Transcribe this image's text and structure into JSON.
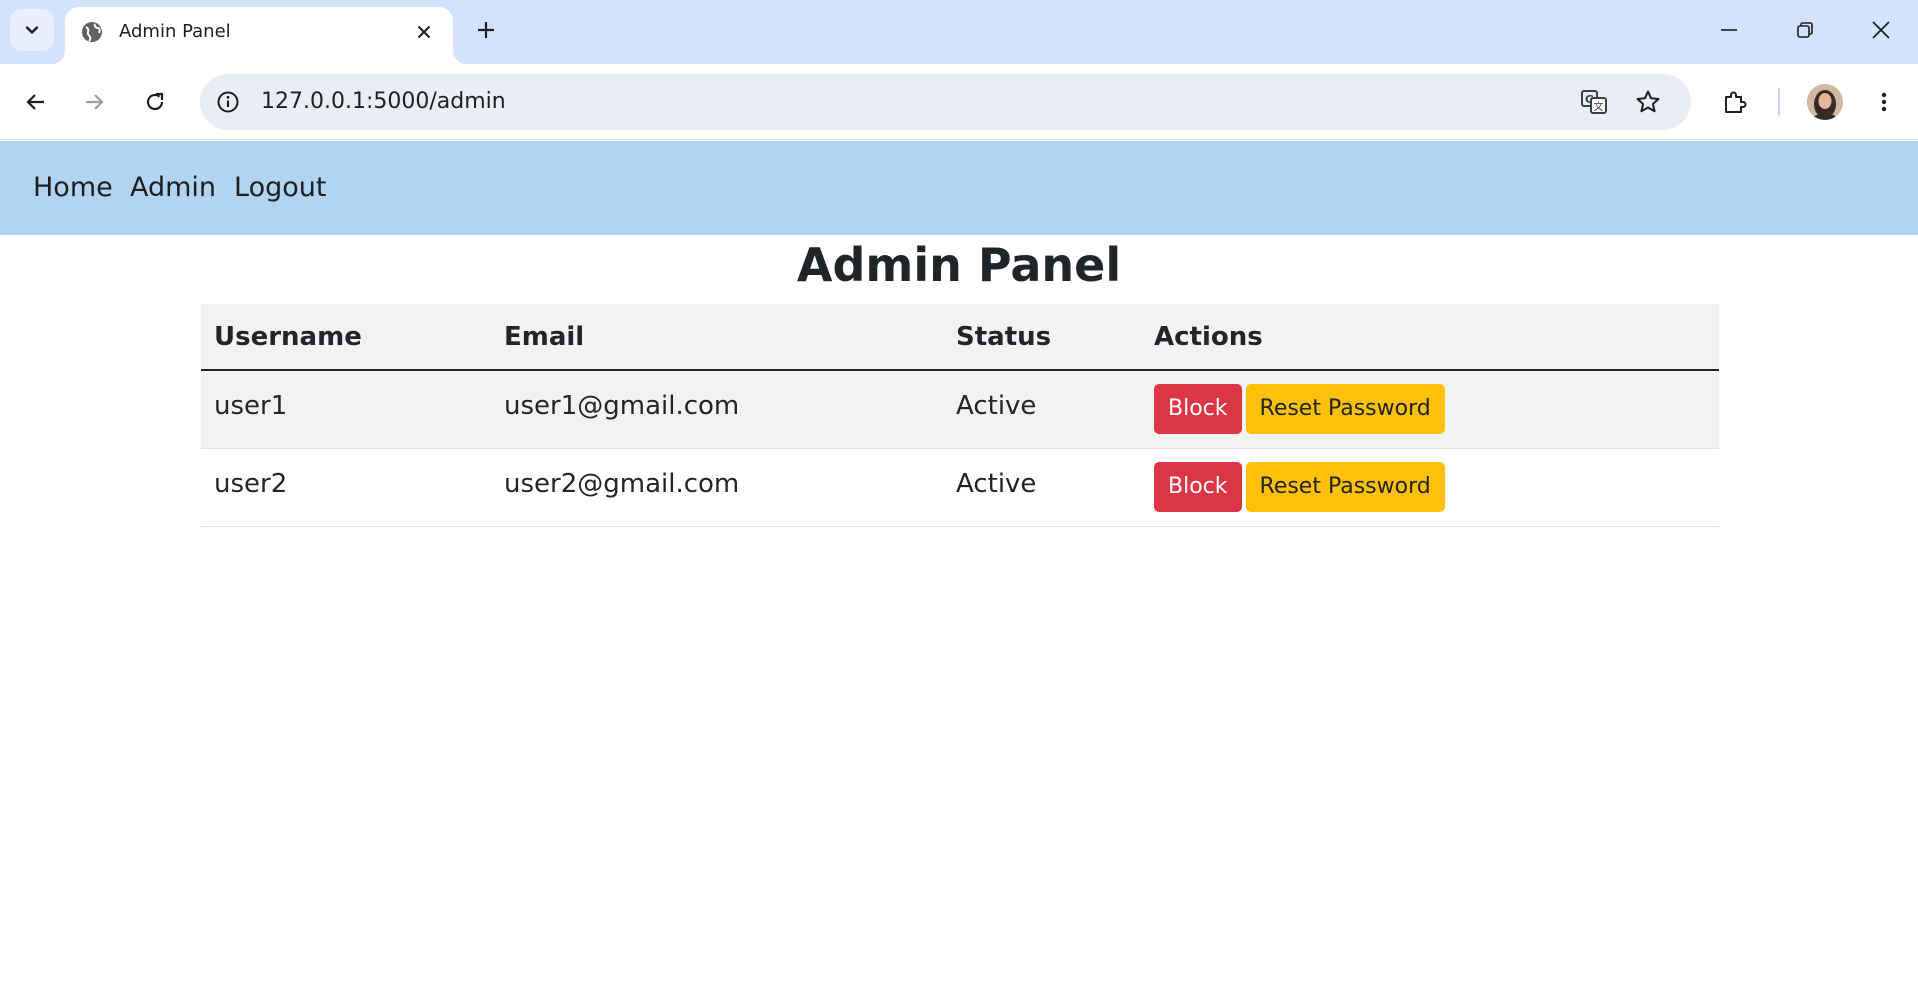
{
  "browser": {
    "tab_title": "Admin Panel",
    "url": "127.0.0.1:5000/admin"
  },
  "nav": {
    "links": [
      "Home",
      "Admin",
      "Logout"
    ]
  },
  "page": {
    "title": "Admin Panel"
  },
  "table": {
    "headers": [
      "Username",
      "Email",
      "Status",
      "Actions"
    ],
    "rows": [
      {
        "username": "user1",
        "email": "user1@gmail.com",
        "status": "Active",
        "block_label": "Block",
        "reset_label": "Reset Password"
      },
      {
        "username": "user2",
        "email": "user2@gmail.com",
        "status": "Active",
        "block_label": "Block",
        "reset_label": "Reset Password"
      }
    ]
  },
  "colors": {
    "navbar_bg": "#b0d4f1",
    "block_button": "#dc3545",
    "reset_button": "#ffc107",
    "tabstrip_bg": "#d3e3fd"
  },
  "icons": {
    "tab_search": "chevron-down-icon",
    "favicon": "globe-icon",
    "tab_close": "close-icon",
    "new_tab": "plus-icon",
    "back": "arrow-left-icon",
    "forward": "arrow-right-icon",
    "reload": "reload-icon",
    "site_info": "info-icon",
    "translate": "translate-icon",
    "bookmark": "star-icon",
    "extensions": "puzzle-icon",
    "menu": "kebab-menu-icon"
  }
}
